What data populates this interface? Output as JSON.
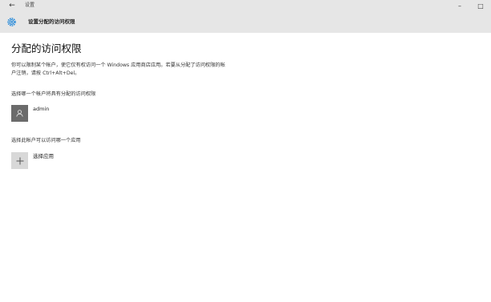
{
  "titlebar": {
    "back_glyph": "←",
    "title": "设置",
    "minimize_glyph": "–",
    "maximize_glyph": "□"
  },
  "header": {
    "icon": "gear-icon",
    "title": "设置分配的访问权限"
  },
  "main": {
    "page_title": "分配的访问权限",
    "description": "你可以限制某个帐户，使它仅有权访问一个 Windows 应用商店应用。若要从分配了访问权限的帐户注销，请按 Ctrl+Alt+Del。",
    "account_section_label": "选择哪一个帐户将具有分配的访问权限",
    "account": {
      "name": "admin",
      "icon": "user-icon"
    },
    "app_section_label": "选择此帐户可以访问哪一个应用",
    "choose_app": {
      "label": "选择应用",
      "icon": "plus-icon"
    }
  },
  "colors": {
    "titlebar_bg": "#e6e6e6",
    "avatar_bg": "#6b6b6b",
    "plus_bg": "#d8d8d8",
    "accent": "#0078d7"
  }
}
